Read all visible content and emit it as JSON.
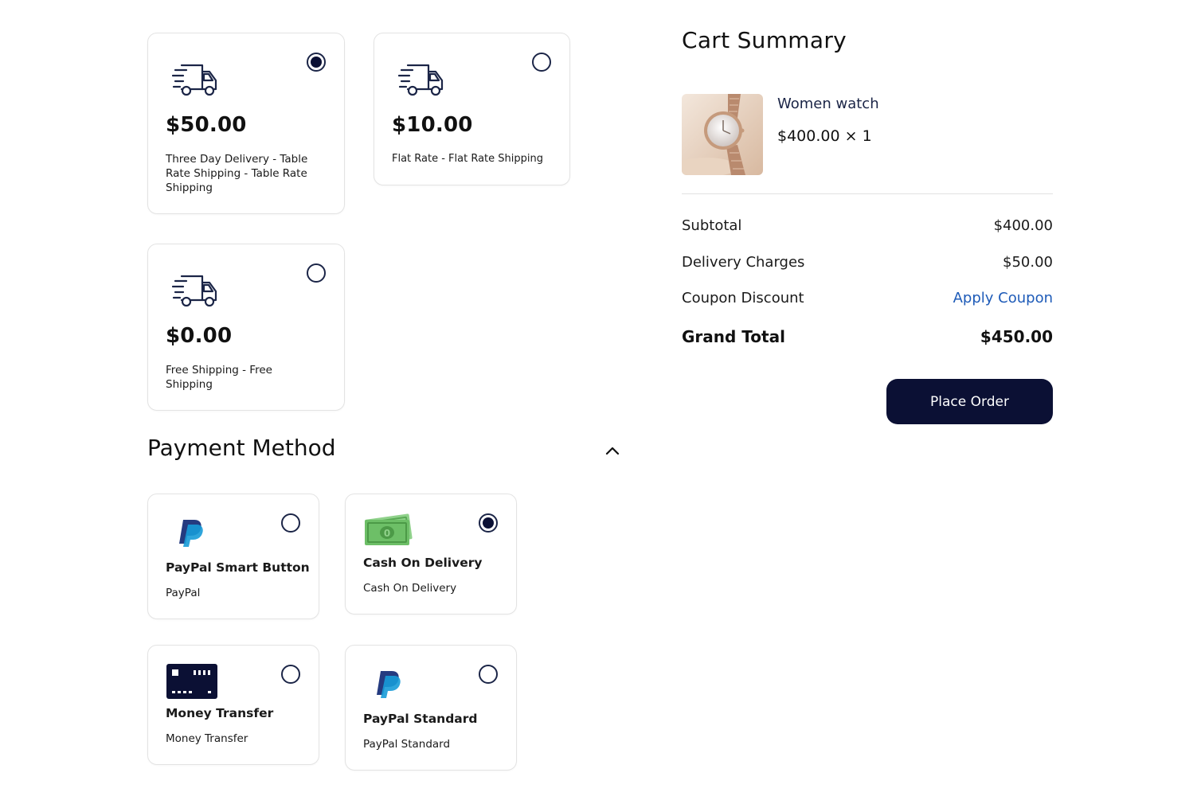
{
  "shipping_methods": [
    {
      "price": "$50.00",
      "description": "Three Day Delivery - Table Rate Shipping - Table Rate Shipping",
      "selected": true,
      "icon": "truck-icon"
    },
    {
      "price": "$10.00",
      "description": "Flat Rate - Flat Rate Shipping",
      "selected": false,
      "icon": "truck-icon"
    },
    {
      "price": "$0.00",
      "description": "Free Shipping - Free Shipping",
      "selected": false,
      "icon": "truck-icon"
    }
  ],
  "payment": {
    "section_title": "Payment Method",
    "collapse_icon": "chevron-up-icon",
    "methods": [
      {
        "title": "PayPal Smart Button",
        "subtitle": "PayPal",
        "icon": "paypal-icon",
        "selected": false
      },
      {
        "title": "Cash On Delivery",
        "subtitle": "Cash On Delivery",
        "icon": "cash-icon",
        "selected": true
      },
      {
        "title": "Money Transfer",
        "subtitle": "Money Transfer",
        "icon": "credit-card-icon",
        "selected": false
      },
      {
        "title": "PayPal Standard",
        "subtitle": "PayPal Standard",
        "icon": "paypal-icon",
        "selected": false
      }
    ]
  },
  "cart": {
    "title": "Cart Summary",
    "item": {
      "name": "Women watch",
      "price_qty": "$400.00 × 1",
      "image": "watch-image"
    },
    "subtotal_label": "Subtotal",
    "subtotal_value": "$400.00",
    "delivery_label": "Delivery Charges",
    "delivery_value": "$50.00",
    "coupon_label": "Coupon Discount",
    "coupon_link": "Apply Coupon",
    "grand_label": "Grand Total",
    "grand_value": "$450.00",
    "place_order_label": "Place Order"
  },
  "colors": {
    "primary": "#0b1034",
    "link": "#1e5bb8",
    "paypal_dark": "#253b80",
    "paypal_light": "#179bd7",
    "cash_green": "#6dbf67"
  }
}
